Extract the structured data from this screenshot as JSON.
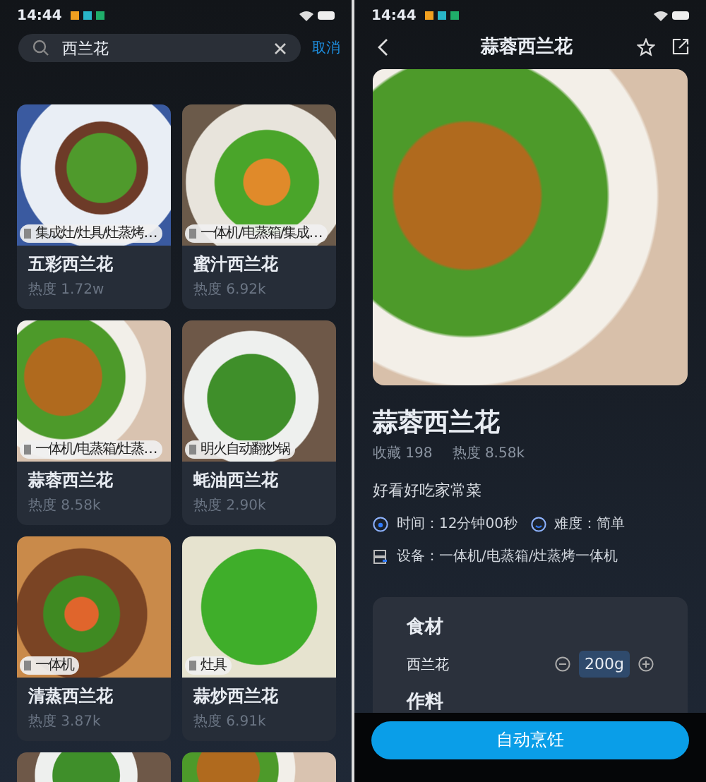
{
  "left_screen": {
    "status_bar": {
      "time": "14:44"
    },
    "search": {
      "value": "西兰花",
      "cancel": "取消"
    },
    "recipes": [
      {
        "name": "五彩西兰花",
        "heat": "热度 1.72w",
        "devices": "集成灶/灶具/灶蒸烤…"
      },
      {
        "name": "蜜汁西兰花",
        "heat": "热度 6.92k",
        "devices": "一体机/电蒸箱/集成…"
      },
      {
        "name": "蒜蓉西兰花",
        "heat": "热度 8.58k",
        "devices": "一体机/电蒸箱/灶蒸…"
      },
      {
        "name": "蚝油西兰花",
        "heat": "热度 2.90k",
        "devices": "明火自动翻炒锅"
      },
      {
        "name": "清蒸西兰花",
        "heat": "热度 3.87k",
        "devices": "一体机"
      },
      {
        "name": "蒜炒西兰花",
        "heat": "热度 6.91k",
        "devices": "灶具"
      }
    ]
  },
  "right_screen": {
    "status_bar": {
      "time": "14:44"
    },
    "header": {
      "title": "蒜蓉西兰花"
    },
    "recipe": {
      "title": "蒜蓉西兰花",
      "favorites": "收藏 198",
      "heat": "热度 8.58k",
      "description": "好看好吃家常菜",
      "time": "时间：12分钟00秒",
      "difficulty": "难度：简单",
      "devices": "设备：一体机/电蒸箱/灶蒸烤一体机"
    },
    "ingredients": {
      "title": "食材",
      "items": [
        {
          "name": "西兰花",
          "amount": "200g"
        }
      ]
    },
    "seasoning": {
      "title": "作料"
    },
    "primary_button": "自动烹饪"
  }
}
